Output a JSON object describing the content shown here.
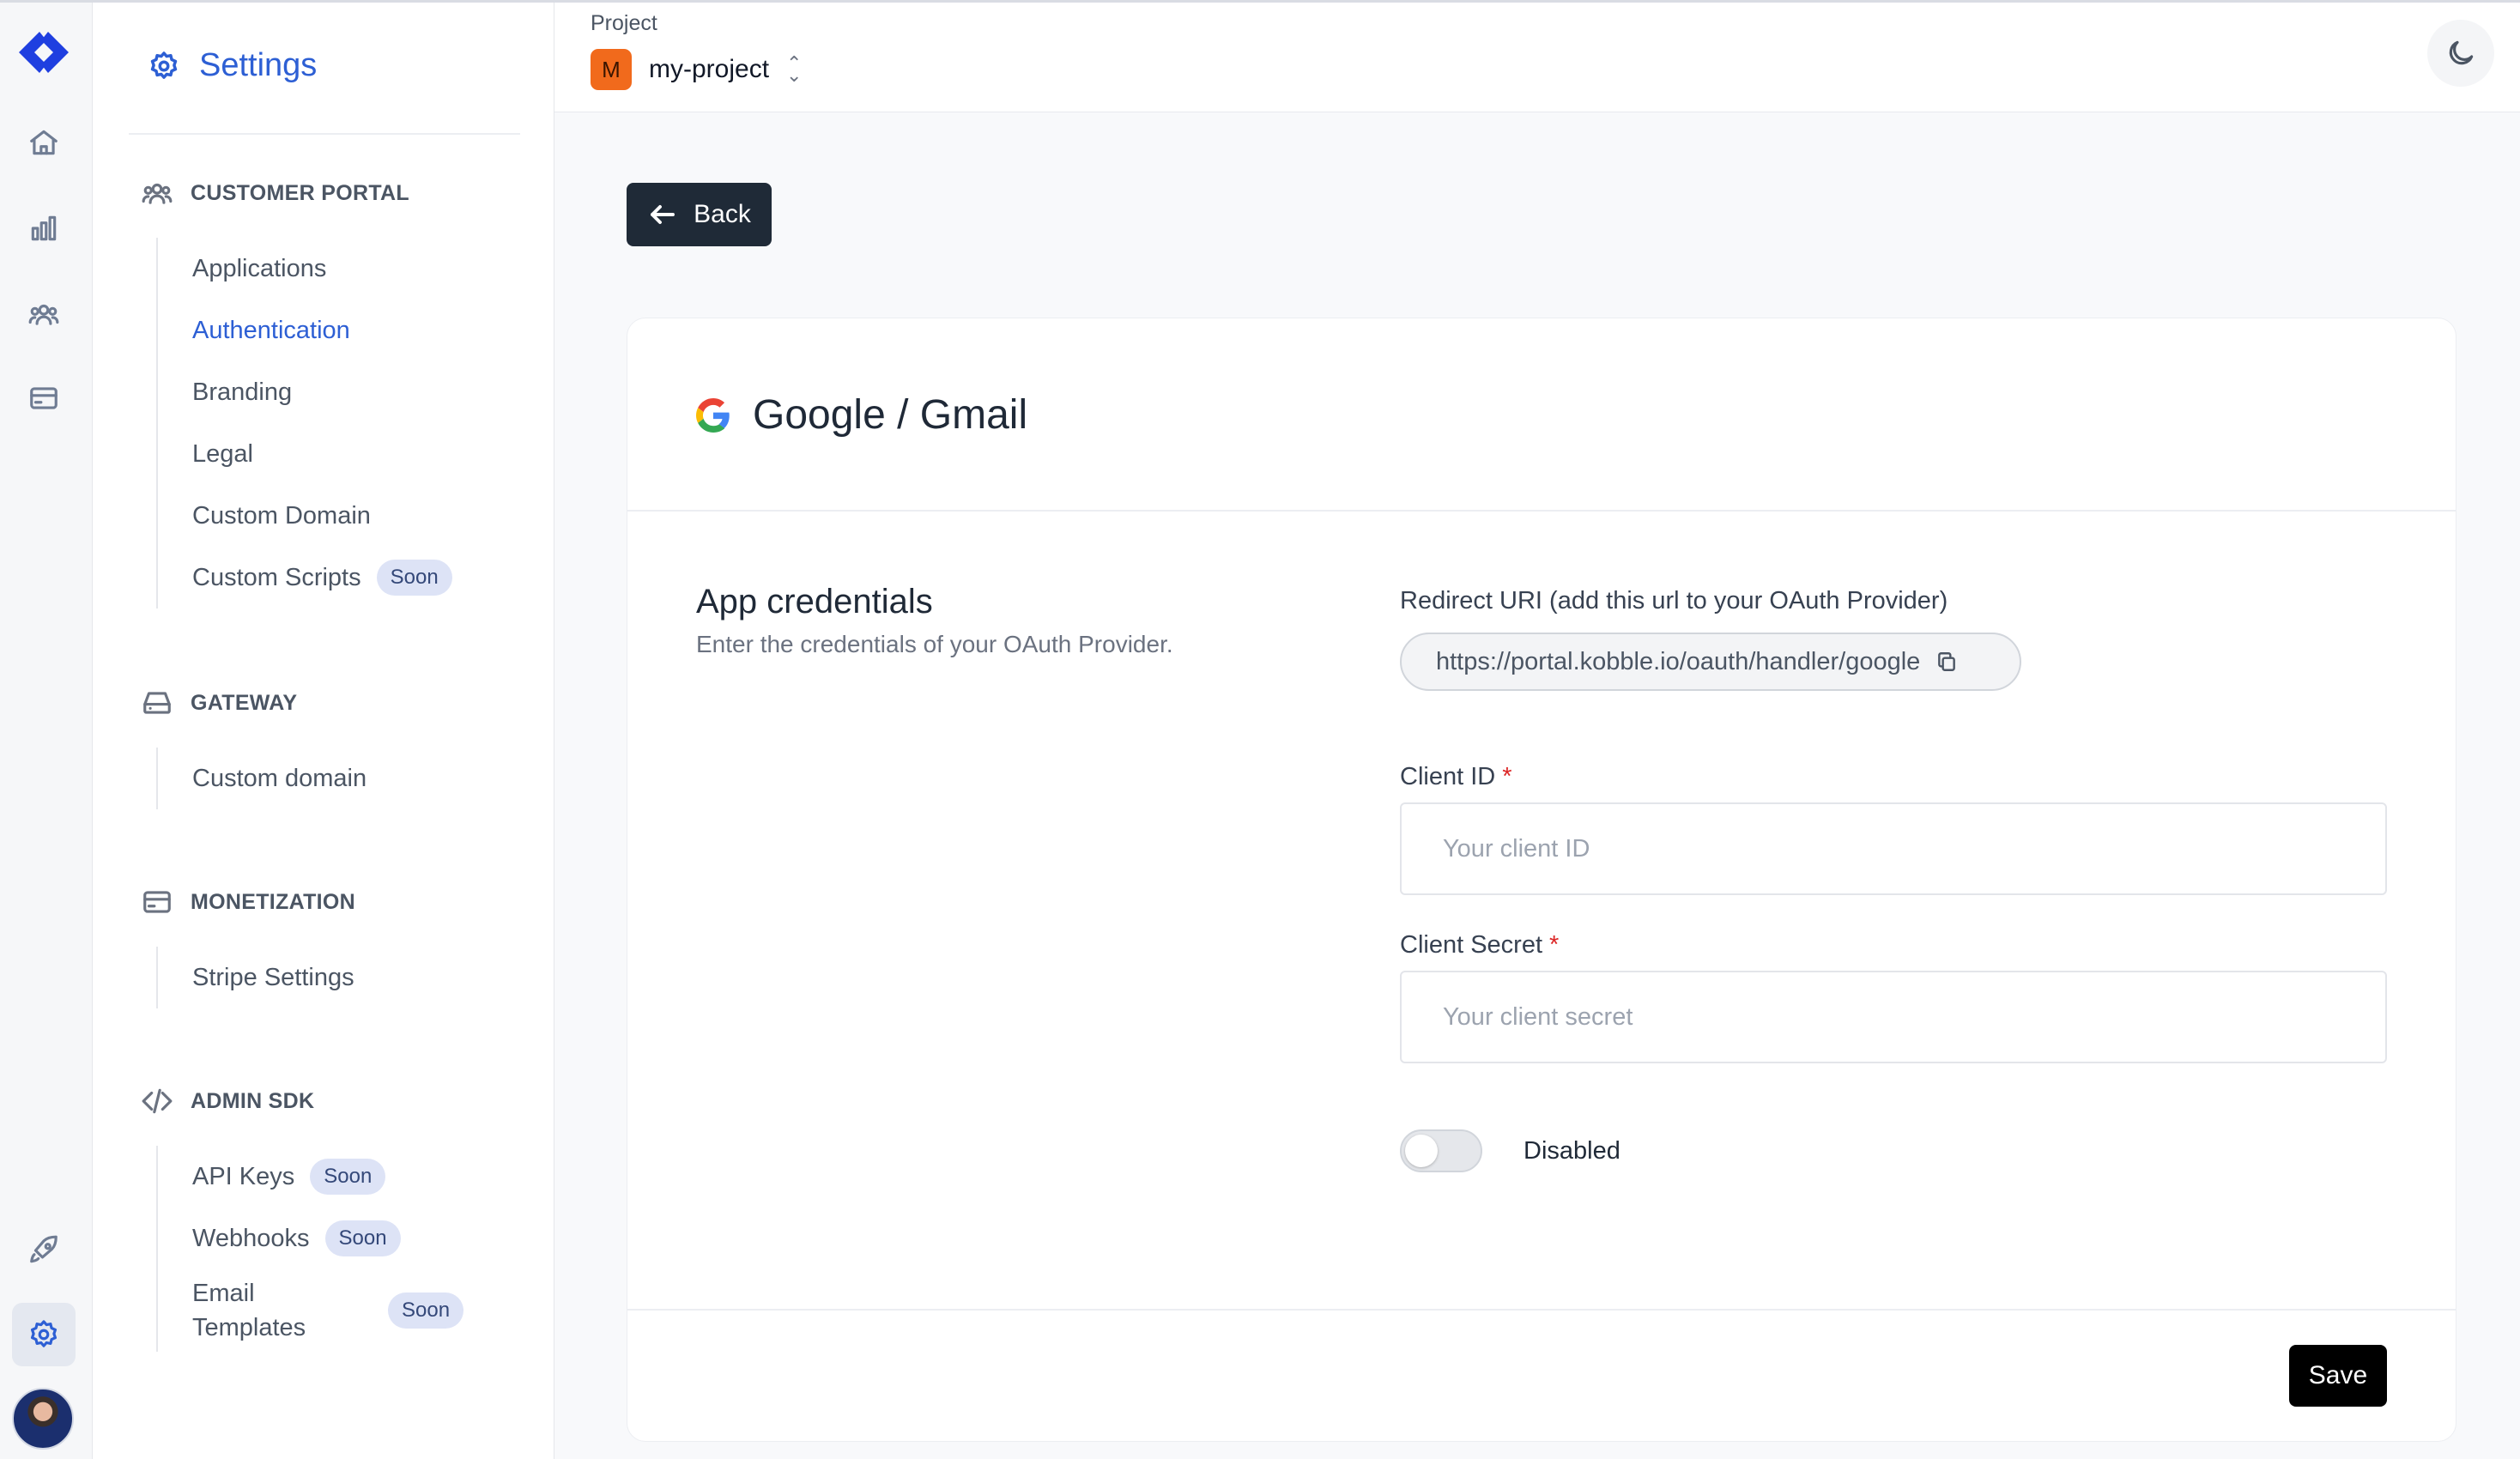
{
  "sidebar": {
    "title": "Settings",
    "sections": [
      {
        "heading": "CUSTOMER PORTAL",
        "items": [
          {
            "label": "Applications"
          },
          {
            "label": "Authentication",
            "active": true
          },
          {
            "label": "Branding"
          },
          {
            "label": "Legal"
          },
          {
            "label": "Custom Domain"
          },
          {
            "label": "Custom Scripts",
            "badge": "Soon"
          }
        ]
      },
      {
        "heading": "GATEWAY",
        "items": [
          {
            "label": "Custom domain"
          }
        ]
      },
      {
        "heading": "MONETIZATION",
        "items": [
          {
            "label": "Stripe Settings"
          }
        ]
      },
      {
        "heading": "ADMIN SDK",
        "items": [
          {
            "label": "API Keys",
            "badge": "Soon"
          },
          {
            "label": "Webhooks",
            "badge": "Soon"
          },
          {
            "label": "Email Templates",
            "badge": "Soon"
          }
        ]
      }
    ]
  },
  "header": {
    "project_label": "Project",
    "project_initial": "M",
    "project_name": "my-project"
  },
  "back_label": "Back",
  "card": {
    "provider_title": "Google / Gmail",
    "credentials_title": "App credentials",
    "credentials_subtitle": "Enter the credentials of your OAuth Provider.",
    "redirect_label": "Redirect URI (add this url to your OAuth Provider)",
    "redirect_uri": "https://portal.kobble.io/oauth/handler/google",
    "client_id_label": "Client ID",
    "client_id_placeholder": "Your client ID",
    "client_id_value": "",
    "client_secret_label": "Client Secret",
    "client_secret_placeholder": "Your client secret",
    "client_secret_value": "",
    "required_marker": "*",
    "toggle_state": false,
    "toggle_label": "Disabled",
    "save_label": "Save"
  },
  "colors": {
    "accent": "#2d5fd4",
    "project_badge": "#f16a1c",
    "dark_button": "#1f2a37",
    "badge_bg": "#dde3f6"
  },
  "icons": {
    "rail": [
      "kobble-logo",
      "home-icon",
      "chart-icon",
      "users-icon",
      "card-icon",
      "rocket-icon",
      "gear-icon"
    ],
    "provider": "google-icon",
    "copy": "copy-icon",
    "theme": "moon-icon"
  }
}
